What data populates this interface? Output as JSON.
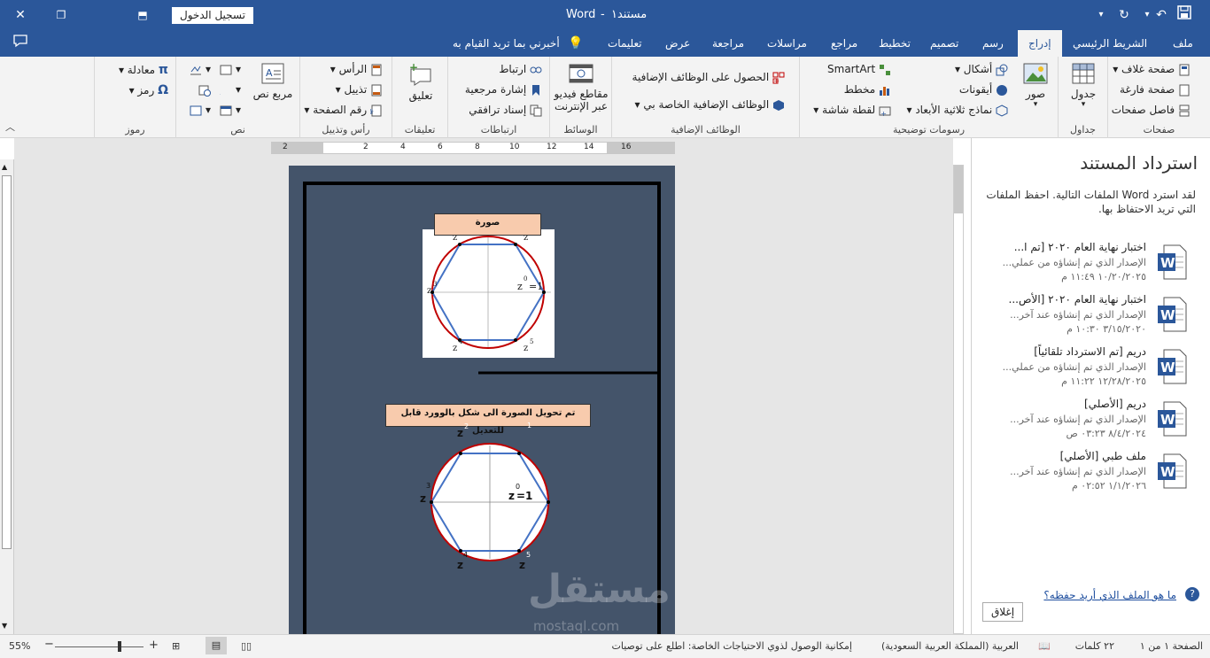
{
  "titlebar": {
    "doc_title": "مستند١",
    "separator": "-",
    "app_name": "Word",
    "login_label": "تسجيل الدخول"
  },
  "tabs": [
    {
      "label": "ملف"
    },
    {
      "label": "الشريط الرئيسي"
    },
    {
      "label": "إدراج"
    },
    {
      "label": "رسم"
    },
    {
      "label": "تصميم"
    },
    {
      "label": "تخطيط"
    },
    {
      "label": "مراجع"
    },
    {
      "label": "مراسلات"
    },
    {
      "label": "مراجعة"
    },
    {
      "label": "عرض"
    },
    {
      "label": "تعليمات"
    }
  ],
  "tellme": "أخبرني بما تريد القيام به",
  "ribbon": {
    "pages": {
      "label": "صفحات",
      "cover": "صفحة غلاف",
      "blank": "صفحة فارغة",
      "break": "فاصل صفحات"
    },
    "tables": {
      "label": "جداول",
      "table": "جدول"
    },
    "illustrations": {
      "label": "رسومات توضيحية",
      "pictures": "صور",
      "shapes": "أشكال",
      "icons": "أيقونات",
      "models3d": "نماذج ثلاثية الأبعاد",
      "smartart": "SmartArt",
      "chart": "مخطط",
      "screenshot": "لقطة شاشة"
    },
    "addins": {
      "label": "الوظائف الإضافية",
      "get": "الحصول على الوظائف الإضافية",
      "my": "الوظائف الإضافية الخاصة بي"
    },
    "media": {
      "label": "الوسائط",
      "video": "مقاطع فيديو عبر الإنترنت"
    },
    "links": {
      "label": "ارتباطات",
      "link": "ارتباط",
      "bookmark": "إشارة مرجعية",
      "crossref": "إسناد ترافقي"
    },
    "comments": {
      "label": "تعليقات",
      "comment": "تعليق"
    },
    "headerfooter": {
      "label": "رأس وتذييل",
      "header": "الرأس",
      "footer": "تذييل",
      "pagenum": "رقم الصفحة"
    },
    "text": {
      "label": "نص",
      "textbox": "مربع نص"
    },
    "symbols": {
      "label": "رموز",
      "equation": "معادلة",
      "symbol": "رمز"
    }
  },
  "document": {
    "box1_label": "صورة",
    "box2_label": "تم تحويل الصورة الى شكل بالوورد قابل للتعديل",
    "fig1": {
      "top_left": "z",
      "top_right": "z",
      "left_base": "z",
      "left_exp": "3",
      "right_base": "z",
      "right_exp": "0",
      "right_eq": "=1",
      "bottom_left_exp": "4",
      "bottom_left": "z",
      "bottom_right_exp": "5",
      "bottom_right": "z"
    },
    "fig2": {
      "top_left_exp": "2",
      "top_left": "z",
      "top_right_exp": "1",
      "left_exp": "3",
      "left": "z",
      "right_base": "z",
      "right_exp": "0",
      "right_eq": "=1",
      "bottom_left_exp": "4",
      "bottom_left": "z",
      "bottom_right_exp": "5",
      "bottom_right": "z"
    },
    "watermark": "مستقل",
    "watermark_sub": "mostaql.com"
  },
  "pane": {
    "title": "استرداد المستند",
    "description": "لقد استرد Word الملفات التالية. احفظ الملفات التي تريد الاحتفاظ بها.",
    "files": [
      {
        "name": "اختبار نهاية العام ٢٠٢٠  [تم ا...",
        "desc": "الإصدار الذي تم إنشاؤه من عملي...",
        "time": "١٠/٢٠/٢٠٢٥ ١١:٤٩ م"
      },
      {
        "name": "اختبار نهاية العام ٢٠٢٠  [الأص...",
        "desc": "الإصدار الذي تم إنشاؤه عند آخر...",
        "time": "٣/١٥/٢٠٢٠ ١٠:٣٠ م"
      },
      {
        "name": "دريم  [تم الاسترداد تلقائياً]",
        "desc": "الإصدار الذي تم إنشاؤه من عملي...",
        "time": "١٢/٢٨/٢٠٢٥ ١١:٢٢ م"
      },
      {
        "name": "دريم  [الأصلي]",
        "desc": "الإصدار الذي تم إنشاؤه عند آخر...",
        "time": "٨/٤/٢٠٢٤ ٠٣:٢٣ ص"
      },
      {
        "name": "ملف طبي  [الأصلي]",
        "desc": "الإصدار الذي تم إنشاؤه عند آخر...",
        "time": "١/١/٢٠٢٦ ٠٢:٥٢ م"
      }
    ],
    "help": "ما هو الملف الذي أريد حفظه؟",
    "close": "إغلاق"
  },
  "status": {
    "page": "الصفحة ١ من ١",
    "words": "٢٢ كلمات",
    "language": "العربية (المملكة العربية السعودية)",
    "accessibility": "إمكانية الوصول لذوي الاحتياجات الخاصة: اطلع على توصيات",
    "zoom": "55%"
  },
  "ruler": {
    "ticks": [
      "2",
      "2",
      "4",
      "6",
      "8",
      "10",
      "12",
      "14",
      "16"
    ]
  },
  "colors": {
    "accent": "#2b579a",
    "page": "#44546a",
    "label_fill": "#f8cbad",
    "circle": "#c00000",
    "hexagon": "#4472c4"
  }
}
